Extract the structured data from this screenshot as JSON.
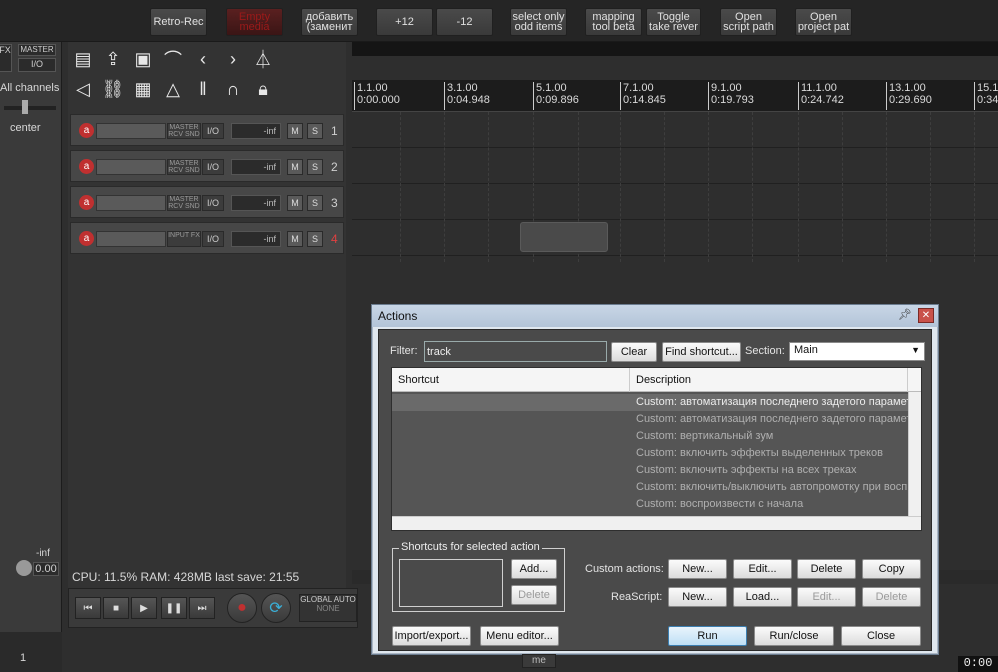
{
  "toolbar": {
    "buttons": [
      {
        "label": "Retro-Rec"
      },
      {
        "label": "Empty\nmedia"
      },
      {
        "label": "добавить\n(заменит"
      },
      {
        "label": "+12"
      },
      {
        "label": "-12"
      },
      {
        "label": "select only\nodd items"
      },
      {
        "label": "mapping\ntool beta"
      },
      {
        "label": "Toggle\ntake rever"
      },
      {
        "label": "Open\nscript path"
      },
      {
        "label": "Open\nproject pat"
      }
    ]
  },
  "left_strip": {
    "fx_label": "FX",
    "master_label": "MASTER",
    "io_label": "I/O",
    "channels_label": "All channels",
    "pan_label": "center",
    "inf_label": "-inf",
    "vol_value": "0.00",
    "track_num": "1"
  },
  "tracks": [
    {
      "number": "1",
      "io_label": "MASTER\nRCV SND",
      "volume": "-inf",
      "armed": false
    },
    {
      "number": "2",
      "io_label": "MASTER\nRCV SND",
      "volume": "-inf",
      "armed": false
    },
    {
      "number": "3",
      "io_label": "MASTER\nRCV SND",
      "volume": "-inf",
      "armed": false
    },
    {
      "number": "4",
      "io_label": "INPUT\nFX",
      "volume": "-inf",
      "armed": true
    }
  ],
  "track_labels": {
    "io": "I/O",
    "mute": "M",
    "solo": "S"
  },
  "status": {
    "cpu": "CPU: 11.5%  RAM: 428MB  last save: 21:55"
  },
  "transport": {
    "global_auto": "GLOBAL AUTO",
    "none": "NONE"
  },
  "ruler": {
    "marks": [
      {
        "bar": "1.1.00",
        "time": "0:00.000"
      },
      {
        "bar": "3.1.00",
        "time": "0:04.948"
      },
      {
        "bar": "5.1.00",
        "time": "0:09.896"
      },
      {
        "bar": "7.1.00",
        "time": "0:14.845"
      },
      {
        "bar": "9.1.00",
        "time": "0:19.793"
      },
      {
        "bar": "11.1.00",
        "time": "0:24.742"
      },
      {
        "bar": "13.1.00",
        "time": "0:29.690"
      },
      {
        "bar": "15.1",
        "time": "0:34"
      }
    ]
  },
  "dialog": {
    "title": "Actions",
    "filter_label": "Filter:",
    "filter_value": "track",
    "clear_label": "Clear",
    "find_shortcut_label": "Find shortcut...",
    "section_label": "Section:",
    "section_value": "Main",
    "columns": {
      "shortcut": "Shortcut",
      "description": "Description"
    },
    "rows": [
      {
        "shortcut": "",
        "description": "Custom: автоматизация последнего задетого параметра",
        "selected": true
      },
      {
        "shortcut": "",
        "description": "Custom: автоматизация последнего задетого параметра",
        "selected": false
      },
      {
        "shortcut": "",
        "description": "Custom: вертикальный зум",
        "selected": false
      },
      {
        "shortcut": "",
        "description": "Custom: включить эффекты выделенных треков",
        "selected": false
      },
      {
        "shortcut": "",
        "description": "Custom: включить эффекты на всех треках",
        "selected": false
      },
      {
        "shortcut": "",
        "description": "Custom: включить/выключить автопромотку при воспроизведении",
        "selected": false
      },
      {
        "shortcut": "",
        "description": "Custom: воспроизвести с начала",
        "selected": false
      }
    ],
    "shortcuts_group_label": "Shortcuts for selected action",
    "add_label": "Add...",
    "delete_label": "Delete",
    "custom_actions_label": "Custom actions:",
    "reascript_label": "ReaScript:",
    "new_label": "New...",
    "edit_label": "Edit...",
    "delete_custom_label": "Delete",
    "copy_label": "Copy",
    "load_label": "Load...",
    "import_export_label": "Import/export...",
    "menu_editor_label": "Menu editor...",
    "run_label": "Run",
    "run_close_label": "Run/close",
    "close_label": "Close"
  },
  "bottom": {
    "me_label": "me",
    "clock": "0:00"
  }
}
